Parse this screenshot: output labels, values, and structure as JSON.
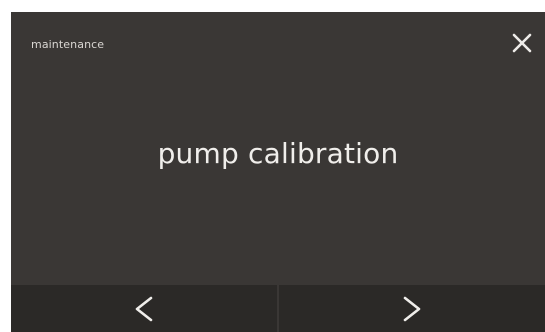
{
  "header": {
    "title": "maintenance",
    "close_icon": "close-icon"
  },
  "main": {
    "label": "pump calibration"
  },
  "nav": {
    "prev_icon": "chevron-left-icon",
    "next_icon": "chevron-right-icon"
  },
  "colors": {
    "background": "#3a3735",
    "nav_background": "#2b2927",
    "text": "#f0eeeb"
  }
}
